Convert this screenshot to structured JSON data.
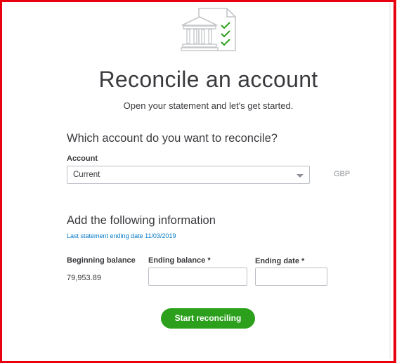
{
  "header": {
    "title": "Reconcile an account",
    "subtitle": "Open your statement and let's get started."
  },
  "account_section": {
    "heading": "Which account do you want to reconcile?",
    "account_label": "Account",
    "account_value": "Current",
    "currency": "GBP"
  },
  "info_section": {
    "heading": "Add the following information",
    "last_statement_hint": "Last statement ending date 11/03/2019",
    "beginning_balance_label": "Beginning balance",
    "beginning_balance_value": "79,953.89",
    "ending_balance_label": "Ending balance *",
    "ending_balance_value": "",
    "ending_date_label": "Ending date *",
    "ending_date_value": ""
  },
  "actions": {
    "start_label": "Start reconciling"
  },
  "colors": {
    "accent_green": "#2ca01c",
    "link_blue": "#0077c5",
    "frame_red": "#e8000f"
  },
  "icons": {
    "hero": "bank-checklist-icon",
    "dropdown": "chevron-down-icon"
  }
}
